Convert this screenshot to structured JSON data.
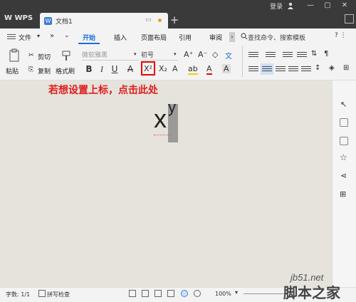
{
  "app": {
    "brand": "WPS",
    "doc_tab": "文档1",
    "login": "登录"
  },
  "menu": {
    "file": "文件",
    "tabs": [
      "开始",
      "插入",
      "页面布局",
      "引用",
      "审阅"
    ],
    "active_tab": "开始",
    "search_placeholder": "查找命令、搜索模板"
  },
  "toolbar": {
    "paste": "粘贴",
    "cut": "剪切",
    "copy": "复制",
    "format_painter": "格式刷",
    "font_name": "微软雅黑",
    "font_size": "初号",
    "bold": "B",
    "italic": "I",
    "underline": "U",
    "strike": "A",
    "superscript": "X²",
    "subscript": "X₂"
  },
  "document": {
    "annotation": "若想设置上标，点击此处",
    "base_text": "x",
    "superscript_text": "y"
  },
  "status": {
    "word_count": "字数: 1/1",
    "spell_check": "拼写检查",
    "zoom": "100%"
  },
  "watermark": {
    "site": "jb51.net",
    "name": "脚本之家"
  },
  "colors": {
    "accent": "#1a6fd8",
    "annotation": "#e01b1b",
    "highlight_box": "#e00000",
    "titlebar": "#3a3a3a"
  }
}
